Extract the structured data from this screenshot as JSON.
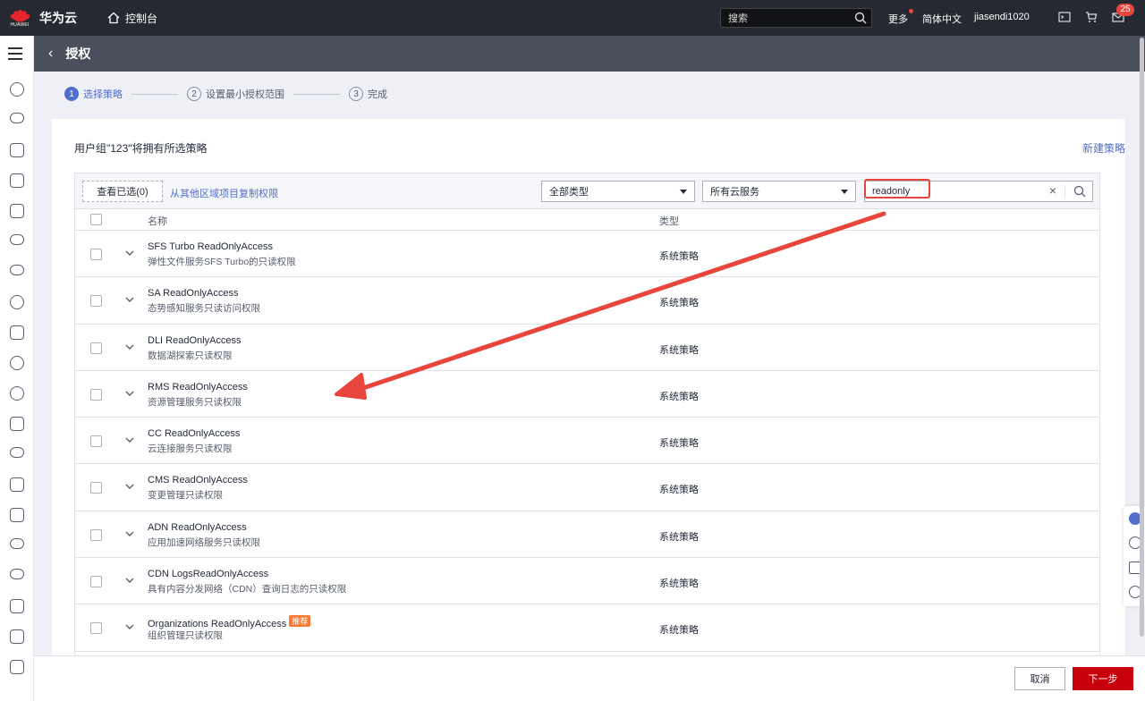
{
  "topbar": {
    "logo_text": "HUAWEI",
    "brand": "华为云",
    "console": "控制台",
    "search_placeholder": "搜索",
    "more": "更多",
    "language": "简体中文",
    "username": "jiasendi1020",
    "message_count": "25"
  },
  "page": {
    "title": "授权"
  },
  "steps": [
    {
      "num": "1",
      "label": "选择策略"
    },
    {
      "num": "2",
      "label": "设置最小授权范围"
    },
    {
      "num": "3",
      "label": "完成"
    }
  ],
  "panel": {
    "heading": "用户组\"123\"将拥有所选策略",
    "new_policy": "新建策略",
    "view_selected": "查看已选(0)",
    "copy_link": "从其他区域项目复制权限",
    "type_filter": "全部类型",
    "service_filter": "所有云服务",
    "search_value": "readonly",
    "col_name": "名称",
    "col_type": "类型"
  },
  "rows": [
    {
      "name": "SFS Turbo ReadOnlyAccess",
      "desc": "弹性文件服务SFS Turbo的只读权限",
      "type": "系统策略",
      "tag": ""
    },
    {
      "name": "SA ReadOnlyAccess",
      "desc": "态势感知服务只读访问权限",
      "type": "系统策略",
      "tag": ""
    },
    {
      "name": "DLI ReadOnlyAccess",
      "desc": "数据湖探索只读权限",
      "type": "系统策略",
      "tag": ""
    },
    {
      "name": "RMS ReadOnlyAccess",
      "desc": "资源管理服务只读权限",
      "type": "系统策略",
      "tag": ""
    },
    {
      "name": "CC ReadOnlyAccess",
      "desc": "云连接服务只读权限",
      "type": "系统策略",
      "tag": ""
    },
    {
      "name": "CMS ReadOnlyAccess",
      "desc": "变更管理只读权限",
      "type": "系统策略",
      "tag": ""
    },
    {
      "name": "ADN ReadOnlyAccess",
      "desc": "应用加速网络服务只读权限",
      "type": "系统策略",
      "tag": ""
    },
    {
      "name": "CDN LogsReadOnlyAccess",
      "desc": "具有内容分发网络（CDN）查询日志的只读权限",
      "type": "系统策略",
      "tag": ""
    },
    {
      "name": "Organizations ReadOnlyAccess",
      "desc": "组织管理只读权限",
      "type": "系统策略",
      "tag": "推荐"
    }
  ],
  "footer": {
    "cancel": "取消",
    "next": "下一步"
  },
  "colors": {
    "accent": "#526ecc",
    "brand_red": "#c7000b",
    "annotation_red": "#e8453c"
  }
}
